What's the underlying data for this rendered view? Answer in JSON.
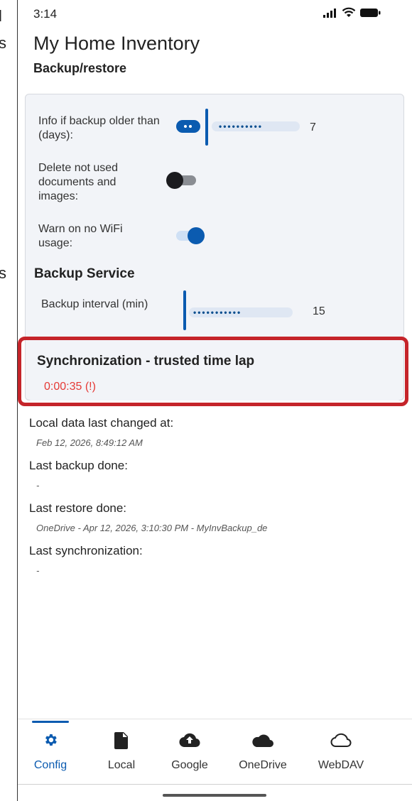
{
  "left_edge": {
    "char1": "l",
    "char2": "s",
    "char3": "s"
  },
  "status_bar": {
    "time": "3:14"
  },
  "app": {
    "title": "My Home Inventory",
    "subtitle": "Backup/restore"
  },
  "settings": {
    "backup_age_label": "Info if backup older than (days):",
    "backup_age_value": "7",
    "delete_unused_label": "Delete not used documents and images:",
    "delete_unused_on": false,
    "warn_wifi_label": "Warn on no WiFi usage:",
    "warn_wifi_on": true,
    "backup_service_heading": "Backup Service",
    "backup_interval_label": "Backup interval (min)",
    "backup_interval_value": "15"
  },
  "sync": {
    "title": "Synchronization - trusted time lap",
    "value": "0:00:35 (!)"
  },
  "info": [
    {
      "label": "Local data last changed at:",
      "value": "Feb 12, 2026, 8:49:12 AM"
    },
    {
      "label": "Last backup done:",
      "value": "-"
    },
    {
      "label": "Last restore done:",
      "value": "OneDrive - Apr 12, 2026, 3:10:30 PM - MyInvBackup_de"
    },
    {
      "label": "Last synchronization:",
      "value": "-"
    }
  ],
  "nav": [
    {
      "label": "Config",
      "icon": "gear-icon",
      "active": true
    },
    {
      "label": "Local",
      "icon": "document-icon",
      "active": false
    },
    {
      "label": "Google",
      "icon": "cloud-upload-icon",
      "active": false
    },
    {
      "label": "OneDrive",
      "icon": "cloud-filled-icon",
      "active": false
    },
    {
      "label": "WebDAV",
      "icon": "cloud-outline-icon",
      "active": false
    }
  ],
  "colors": {
    "accent": "#0b5bb0",
    "highlight_border": "#c5242a",
    "warning_text": "#e53935"
  }
}
